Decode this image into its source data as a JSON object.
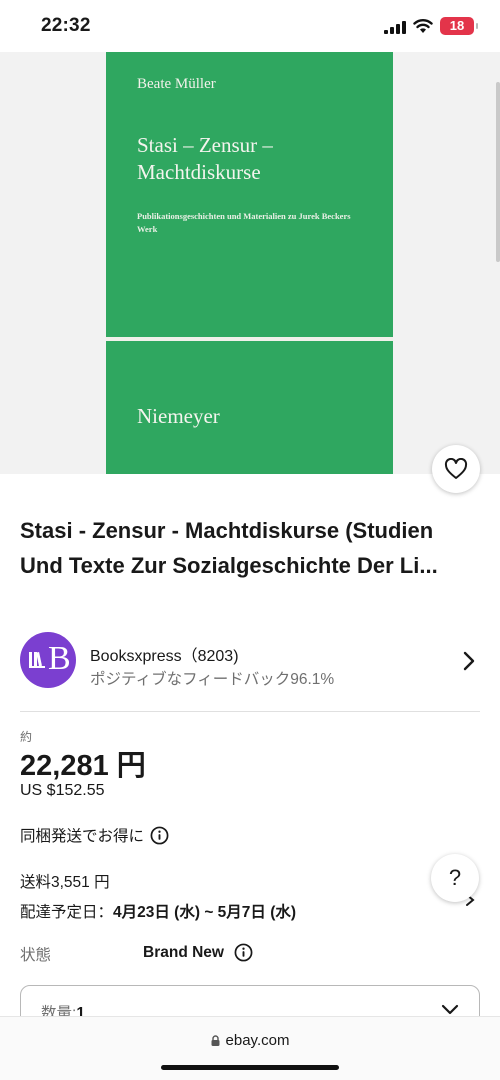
{
  "status_bar": {
    "time": "22:32",
    "battery": "18",
    "icons": [
      "signal-icon",
      "wifi-icon",
      "battery-icon"
    ]
  },
  "product_image": {
    "cover_author": "Beate Müller",
    "cover_title": "Stasi – Zensur – Machtdiskurse",
    "cover_subtitle": "Publikationsgeschichten und Materialien zu Jurek Beckers Werk",
    "cover_publisher": "Niemeyer",
    "cover_color": "#2fa760"
  },
  "watch_button": {
    "icon": "heart-icon"
  },
  "listing": {
    "title": "Stasi - Zensur - Machtdiskurse (Studien Und Texte Zur Sozialgeschichte Der Li..."
  },
  "seller": {
    "avatar_letter": "B",
    "avatar_color": "#7b3fd0",
    "name": "Booksxpress（8203)",
    "feedback": "ポジティブなフィードバック96.1%"
  },
  "price": {
    "prefix": "約",
    "amount": "22,281 円",
    "usd": "US $152.55"
  },
  "bundle": {
    "label": "同梱発送でお得に"
  },
  "shipping": {
    "cost": "送料3,551 円",
    "delivery_label": "配達予定日：",
    "delivery_range": "4月23日 (水) ~ 5月7日 (水)"
  },
  "condition": {
    "label": "状態",
    "value": "Brand New"
  },
  "quantity": {
    "label": "数量:",
    "value": "1"
  },
  "help_button": {
    "label": "?"
  },
  "url_bar": {
    "domain": "ebay.com"
  }
}
